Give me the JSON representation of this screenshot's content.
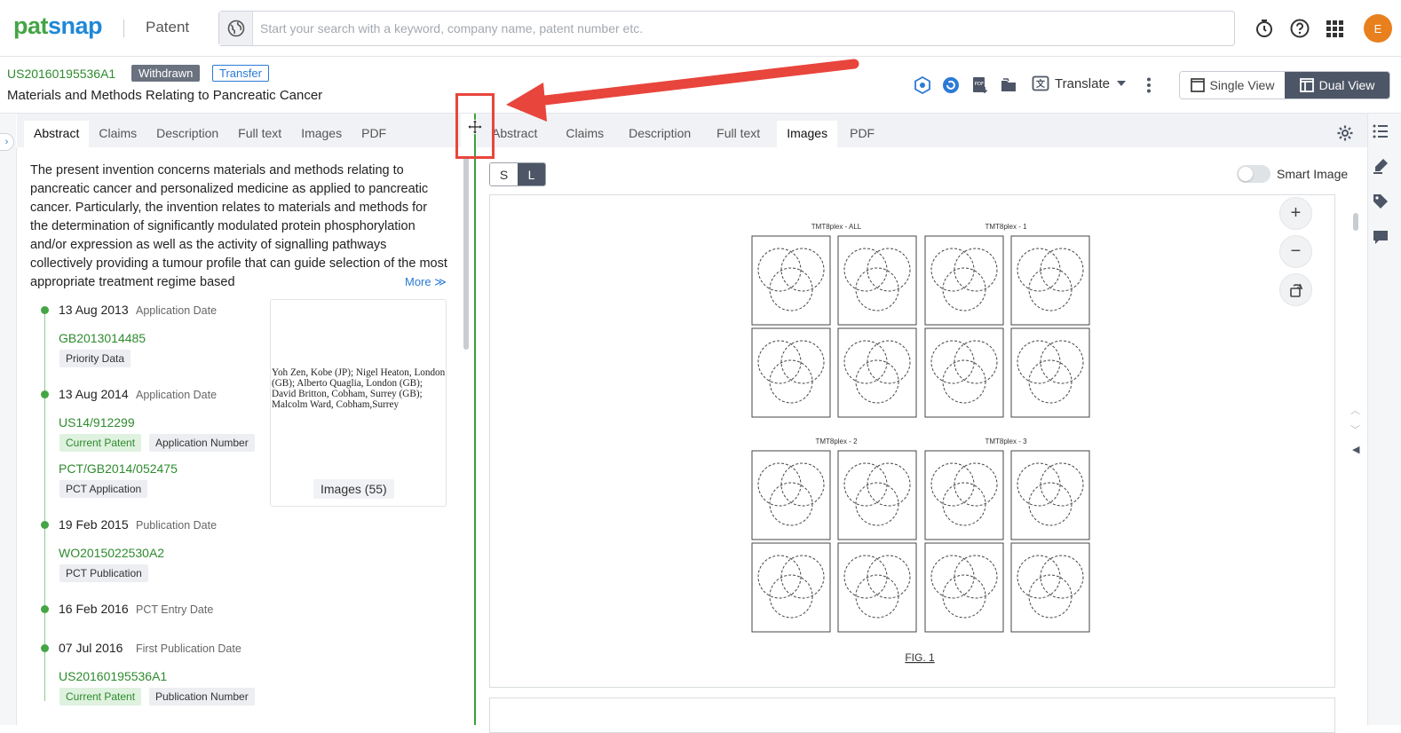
{
  "header": {
    "logo_part1": "pat",
    "logo_part2": "snap",
    "product": "Patent",
    "search_placeholder": "Start your search with a keyword, company name, patent number etc.",
    "avatar_letter": "E"
  },
  "document": {
    "patent_number": "US20160195536A1",
    "status_tag": "Withdrawn",
    "transfer_tag": "Transfer",
    "title": "Materials and Methods Relating to Pancreatic Cancer",
    "translate_label": "Translate",
    "single_view": "Single View",
    "dual_view": "Dual View"
  },
  "left_tabs": [
    "Abstract",
    "Claims",
    "Description",
    "Full text",
    "Images",
    "PDF"
  ],
  "right_tabs": [
    "Abstract",
    "Claims",
    "Description",
    "Full text",
    "Images",
    "PDF"
  ],
  "abstract": {
    "text": "The present invention concerns materials and methods relating to pancreatic cancer and personalized medicine as applied to pancreatic cancer. Particularly, the invention relates to materials and methods for the determination of significantly modulated protein phosphorylation and/or expression as well as the activity of signalling pathways collectively providing a tumour profile that can guide selection of the most appropriate treatment regime based",
    "more": "More"
  },
  "timeline": {
    "e1_date": "13 Aug 2013",
    "e1_type": "Application Date",
    "e1_link": "GB2013014485",
    "e1_chip": "Priority Data",
    "e2_date": "13 Aug 2014",
    "e2_type": "Application Date",
    "e2_link": "US14/912299",
    "e2_chip1": "Current Patent",
    "e2_chip2": "Application Number",
    "e2_link2": "PCT/GB2014/052475",
    "e2_chip3": "PCT Application",
    "e3_date": "19 Feb 2015",
    "e3_type": "Publication Date",
    "e3_link": "WO2015022530A2",
    "e3_chip": "PCT Publication",
    "e4_date": "16 Feb 2016",
    "e4_type": "PCT Entry Date",
    "e5_date": "07 Jul 2016",
    "e5_type": "First Publication Date",
    "e5_link": "US20160195536A1",
    "e5_chip1": "Current Patent",
    "e5_chip2": "Publication Number"
  },
  "image_card": {
    "inventors_html_free": "Yoh Zen, Kobe (JP); Nigel Heaton, London (GB); Alberto Quaglia, London (GB); David Britton, Cobham, Surrey (GB); Malcolm Ward, Cobham,Surrey",
    "count_label": "Images (55)"
  },
  "viewer": {
    "size_s": "S",
    "size_l": "L",
    "smart_image": "Smart Image",
    "zoom_in": "+",
    "zoom_out": "−",
    "fig_caption": "FIG. 1",
    "panel_titles": [
      "TMT8plex - ALL",
      "TMT8plex - 1",
      "TMT8plex - 2",
      "TMT8plex - 3"
    ]
  }
}
